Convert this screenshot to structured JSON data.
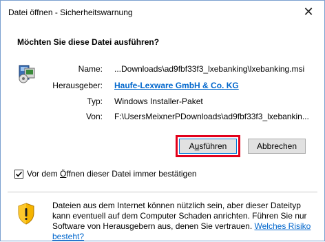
{
  "window": {
    "title": "Datei öffnen - Sicherheitswarnung",
    "close_glyph": "✕"
  },
  "dialog": {
    "question": "Möchten Sie diese Datei ausführen?",
    "icon": "windows-installer-icon",
    "rows": [
      {
        "label": "Name:",
        "value": "...Downloads\\ad9fbf33f3_lxebanking\\lxebanking.msi"
      },
      {
        "label": "Herausgeber:",
        "value": "Haufe-Lexware GmbH & Co. KG"
      },
      {
        "label": "Typ:",
        "value": "Windows Installer-Paket"
      },
      {
        "label": "Von:",
        "value": "F:\\UsersMeixnerPDownloads\\ad9fbf33f3_lxebankin..."
      }
    ]
  },
  "buttons": {
    "run_pre": "A",
    "run_u": "u",
    "run_post": "sführen",
    "cancel": "Abbrechen"
  },
  "checkbox": {
    "checked": true,
    "label_pre": "Vor dem ",
    "label_u": "Ö",
    "label_post": "ffnen dieser Datei immer bestätigen"
  },
  "warning": {
    "icon": "shield-warning-icon",
    "text": "Dateien aus dem Internet können nützlich sein, aber dieser Dateityp kann eventuell auf dem Computer Schaden anrichten. Führen Sie nur Software von Herausgebern aus, denen Sie vertrauen. ",
    "link": "Welches Risiko besteht?"
  },
  "colors": {
    "link": "#0066cc",
    "highlight": "#e3001b",
    "button_focus": "#0078d7"
  }
}
